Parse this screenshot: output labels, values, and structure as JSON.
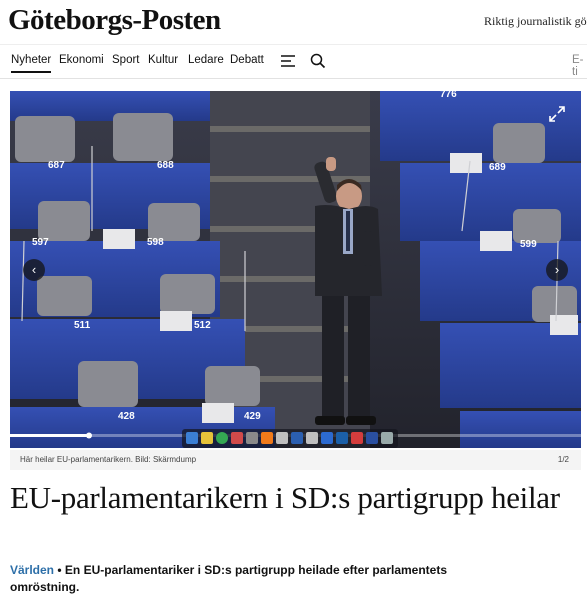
{
  "header": {
    "logo_text": "Göteborgs-Posten",
    "tagline": "Riktig journalistik gör s"
  },
  "nav": {
    "items": [
      "Nyheter",
      "Ekonomi",
      "Sport",
      "Kultur",
      "Ledare",
      "Debatt"
    ],
    "active": "Nyheter",
    "right_text": "E-ti"
  },
  "media": {
    "seat_numbers": [
      "687",
      "688",
      "689",
      "597",
      "598",
      "599",
      "511",
      "512",
      "428",
      "429",
      "776"
    ],
    "caption": "Här heilar EU-parlamentarikern. Bild: Skärmdump",
    "counter": "1/2",
    "prev_icon": "chevron-left-icon",
    "next_icon": "chevron-right-icon",
    "expand_icon": "expand-icon"
  },
  "article": {
    "headline": "EU-parlamentarikern i SD:s partigrupp heilar",
    "category": "Världen",
    "bullet": "•",
    "lead": "En EU-parlamentariker i SD:s partigrupp heilade efter parlamentets omröstning."
  },
  "colors": {
    "category": "#2d6fa8",
    "seat_blue": "#2f3f8f"
  }
}
